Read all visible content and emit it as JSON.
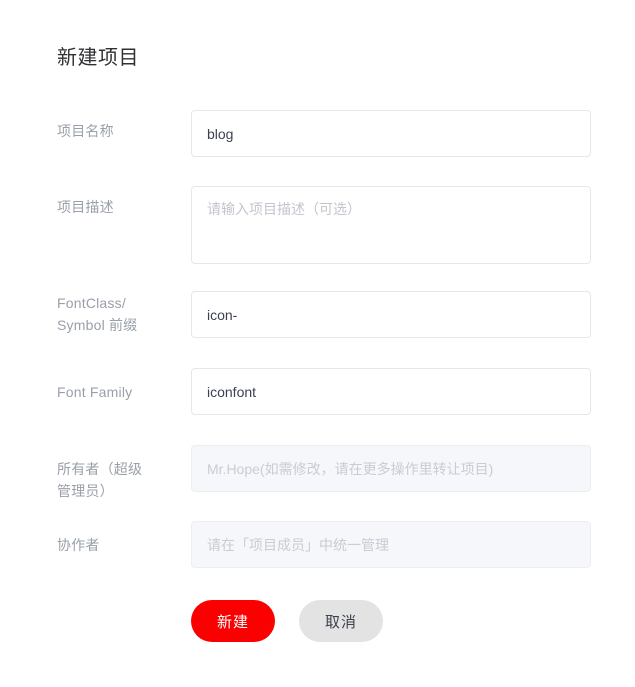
{
  "form": {
    "title": "新建项目",
    "fields": [
      {
        "key": "project_name",
        "label": "项目名称",
        "value": "blog",
        "placeholder": "",
        "type": "text",
        "disabled": false
      },
      {
        "key": "project_description",
        "label": "项目描述",
        "value": "",
        "placeholder": "请输入项目描述（可选）",
        "type": "textarea",
        "disabled": false
      },
      {
        "key": "fontclass_symbol_prefix",
        "label": "FontClass/Symbol 前缀",
        "label_line1": "FontClass/",
        "label_line2": "Symbol 前缀",
        "value": "icon-",
        "placeholder": "",
        "type": "text",
        "disabled": false
      },
      {
        "key": "font_family",
        "label": "Font Family",
        "value": "iconfont",
        "placeholder": "",
        "type": "text",
        "disabled": false
      },
      {
        "key": "owner",
        "label": "所有者（超级管理员）",
        "label_line1": "所有者（超级",
        "label_line2": "管理员）",
        "value": "",
        "placeholder": "Mr.Hope(如需修改，请在更多操作里转让项目)",
        "type": "text",
        "disabled": true
      },
      {
        "key": "collaborators",
        "label": "协作者",
        "value": "",
        "placeholder": "请在「项目成员」中统一管理",
        "type": "text",
        "disabled": true
      }
    ],
    "actions": {
      "submit_label": "新建",
      "cancel_label": "取消"
    }
  },
  "colors": {
    "primary": "#fb0000",
    "primary_text": "#ffffff",
    "cancel_bg": "#e3e3e3",
    "cancel_text": "#3c4150",
    "label": "#9aa0a9",
    "input_text": "#3c4150",
    "placeholder": "#c3c6cd",
    "border": "#e4e7ed",
    "disabled_bg": "#f5f7fa",
    "page_bg": "#ffffff"
  }
}
